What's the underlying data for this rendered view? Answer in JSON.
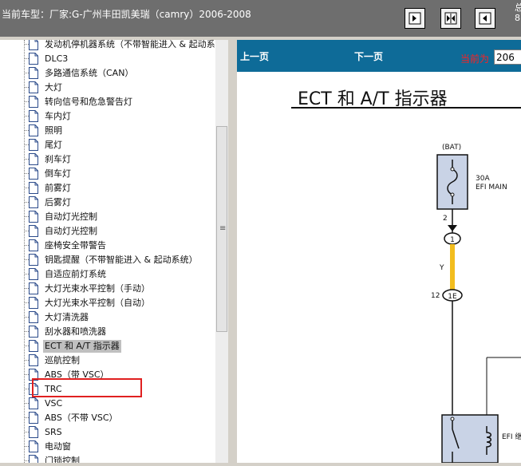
{
  "window": {
    "title": "当前车型：厂家:G-广州丰田凯美瑞（camry）2006-2008",
    "corner_text": [
      "总",
      "8"
    ]
  },
  "toolbar": {
    "buttons": [
      "expand-right-icon",
      "expand-both-icon",
      "collapse-left-icon"
    ]
  },
  "tree": {
    "items": [
      "发动机停机器系统（不带智能进入 & 起动系",
      "DLC3",
      "多路通信系统（CAN）",
      "大灯",
      "转向信号和危急警告灯",
      "车内灯",
      "照明",
      "尾灯",
      "刹车灯",
      "倒车灯",
      "前雾灯",
      "后雾灯",
      "自动灯光控制",
      "自动灯光控制",
      "座椅安全带警告",
      "钥匙提醒（不带智能进入 & 起动系统）",
      "自适应前灯系统",
      "大灯光束水平控制（手动）",
      "大灯光束水平控制（自动）",
      "大灯清洗器",
      "刮水器和喷洗器",
      "ECT 和 A/T 指示器",
      "巡航控制",
      "ABS（带 VSC）",
      "TRC",
      "VSC",
      "ABS（不带 VSC）",
      "SRS",
      "电动窗",
      "门锁控制"
    ],
    "selected": "ECT 和 A/T 指示器"
  },
  "nav": {
    "prev": "上一页",
    "next": "下一页",
    "current_label": "当前为",
    "current_page": "206"
  },
  "document": {
    "title": "ECT 和 A/T 指示器",
    "bat_label": "(BAT)",
    "fuse_amp": "30A",
    "fuse_name": "EFI MAIN",
    "pin_top": "2",
    "connector_1": "1",
    "wire_color": "Y",
    "pin_12": "12",
    "connector_1e": "1E",
    "relay_label": "EFI 继"
  }
}
